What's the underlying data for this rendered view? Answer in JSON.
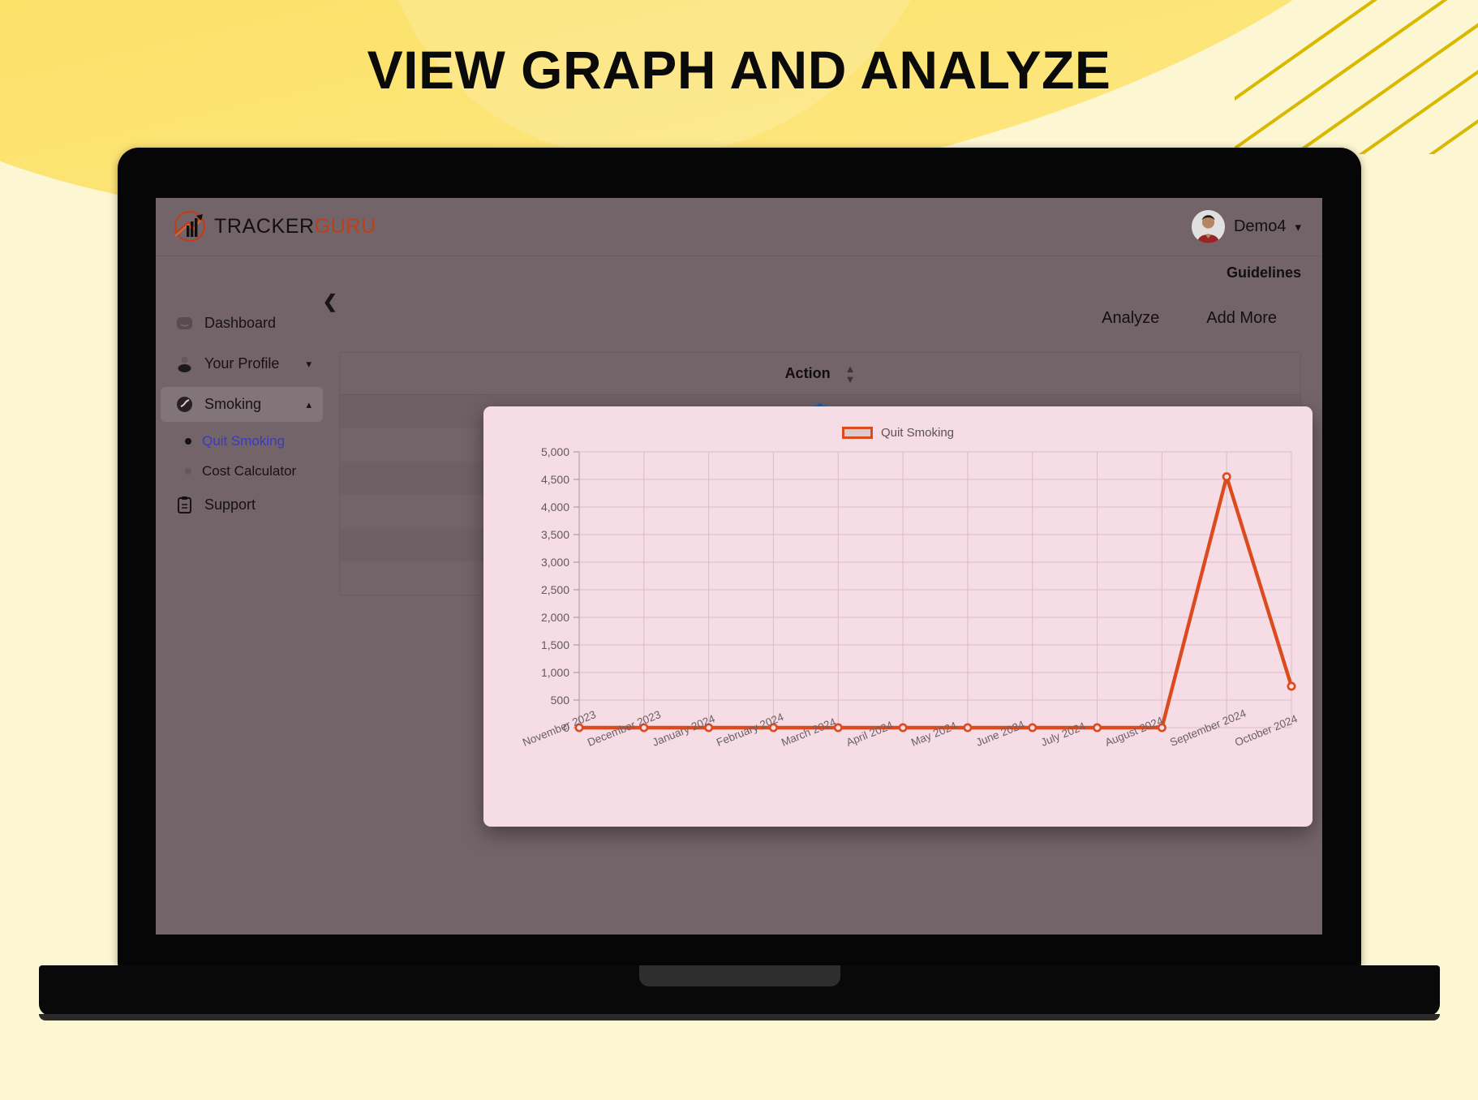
{
  "banner": {
    "title": "VIEW GRAPH AND ANALYZE"
  },
  "app": {
    "brand": {
      "primary": "TRACKER",
      "secondary": "GURU",
      "logo_icon": "chart-arrow-logo"
    },
    "user": {
      "name": "Demo4",
      "avatar_icon": "user-avatar",
      "caret_icon": "chevron-down-icon"
    },
    "subbar": {
      "guidelines": "Guidelines"
    },
    "sidebar": {
      "collapse_icon": "chevron-left-icon",
      "items": [
        {
          "label": "Dashboard",
          "icon": "dashboard-icon",
          "active": false,
          "expandable": false
        },
        {
          "label": "Your Profile",
          "icon": "user-icon",
          "active": false,
          "expandable": true,
          "chevron": "chevron-down-icon"
        },
        {
          "label": "Smoking",
          "icon": "smoking-icon",
          "active": true,
          "expandable": true,
          "chevron": "chevron-up-icon"
        },
        {
          "label": "Support",
          "icon": "clipboard-icon",
          "active": false,
          "expandable": false
        }
      ],
      "sub_items": [
        {
          "label": "Quit Smoking",
          "active": true
        },
        {
          "label": "Cost Calculator",
          "active": false
        }
      ]
    },
    "content": {
      "actions": [
        "Analyze",
        "Add More"
      ],
      "table": {
        "columns": [
          "Action"
        ],
        "sort_icon": "sort-updown-icon",
        "row_icon": "trash-icon",
        "row_count": 6
      }
    }
  },
  "chart_data": {
    "type": "line",
    "title": "",
    "legend": [
      {
        "name": "Quit Smoking",
        "color": "#DC4B1E"
      }
    ],
    "legend_position": "top-center",
    "categories": [
      "November 2023",
      "December 2023",
      "January 2024",
      "February 2024",
      "March 2024",
      "April 2024",
      "May 2024",
      "June 2024",
      "July 2024",
      "August 2024",
      "September 2024",
      "October 2024"
    ],
    "series": [
      {
        "name": "Quit Smoking",
        "values": [
          0,
          0,
          0,
          0,
          0,
          0,
          0,
          0,
          0,
          0,
          4550,
          750
        ]
      }
    ],
    "xlabel": "",
    "ylabel": "",
    "ylim": [
      0,
      5000
    ],
    "yticks": [
      0,
      500,
      1000,
      1500,
      2000,
      2500,
      3000,
      3500,
      4000,
      4500,
      5000
    ],
    "ytick_labels": [
      "0",
      "500",
      "1,000",
      "1,500",
      "2,000",
      "2,500",
      "3,000",
      "3,500",
      "4,000",
      "4,500",
      "5,000"
    ],
    "grid": true,
    "line_color": "#DC4B1E",
    "plot_bg": "#F6DCE5"
  },
  "colors": {
    "accent": "#DC4B1E",
    "brand_secondary": "#C8431B",
    "app_bg": "#7A6A70",
    "banner_bg": "#FDF6D2",
    "banner_swoosh": "#FBDC4B",
    "link": "#3E3EC9",
    "trash": "#2F5F9E"
  }
}
